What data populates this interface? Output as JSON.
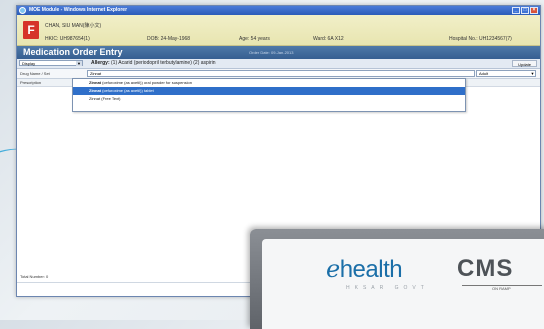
{
  "window": {
    "title": "MOE Module - Windows Internet Explorer",
    "controls": [
      "_",
      "□",
      "×"
    ]
  },
  "patient": {
    "badge": "F",
    "name": "CHAN, SIU MAN(陳小文)",
    "hkic": "HKIC: UH987654(1)",
    "dob": "DOB: 24-May-1968",
    "age": "Age: 54 years",
    "ward": "Ward: 6A X12",
    "hospital_no": "Hospital No.: UH1234567(7)"
  },
  "moe": {
    "title": "Medication Order Entry",
    "order_date": "Order Date: 09-Jan-2013"
  },
  "toolbar": {
    "display_value": "Display",
    "allergy_label": "Allergy:",
    "allergy_text": "(1) Acarid (periodopril terbutylamine) (2) aspirin",
    "update_label": "Update"
  },
  "search": {
    "label": "Drug Name / Set",
    "value": "Zinnat",
    "population": "Adult"
  },
  "prescription": {
    "label": "Prescription",
    "total": "Total Number: 0"
  },
  "suggestions": [
    {
      "name": "Zinnat",
      "detail": "(cefuroxime (as axetil)) oral powder for suspension"
    },
    {
      "name": "Zinnat",
      "detail": "(cefuroxime (as axetil)) tablet"
    },
    {
      "name": "Zinnat",
      "detail": "(Free Text)"
    }
  ],
  "branding": {
    "ehealth_e": "e",
    "ehealth": "health",
    "ehealth_sub": "HKSAR GOVT",
    "cms": "CMS",
    "onramp": "ON RAMP"
  },
  "colors": {
    "titlebar": "#2b5cb8",
    "patient_banner": "#e8e5b0",
    "moe_bar": "#365f91",
    "selected_suggestion": "#2f6fc9",
    "badge": "#d6332a"
  }
}
